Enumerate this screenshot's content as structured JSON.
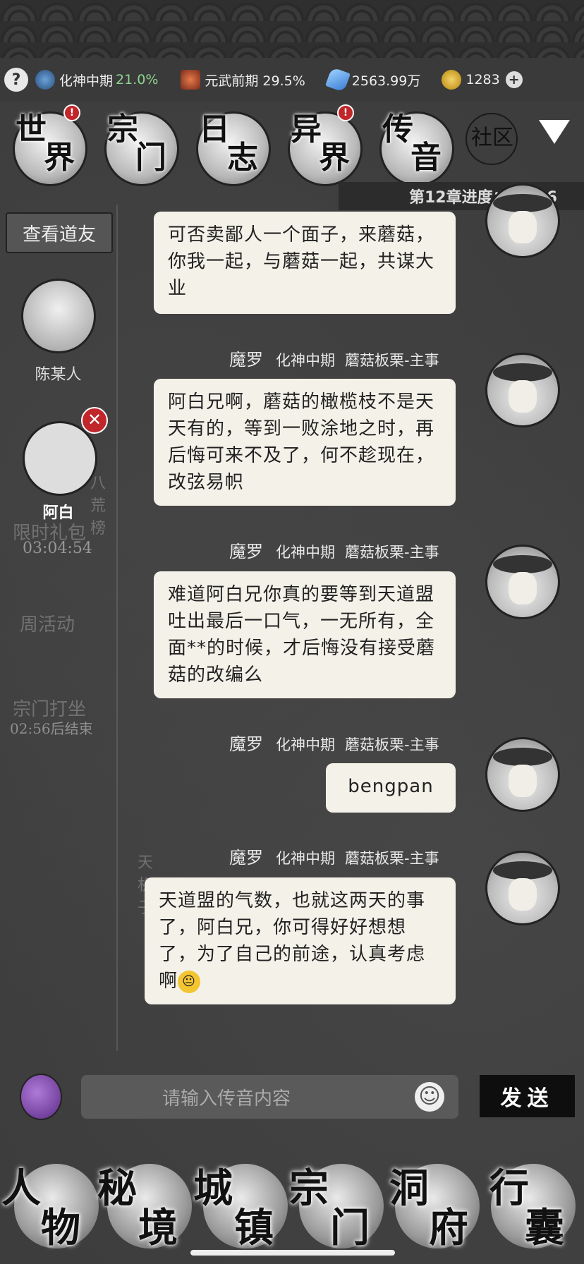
{
  "status": {
    "realm1_name": "化神中期",
    "realm1_pct": "21.0%",
    "realm2": "元武前期 29.5%",
    "stones": "2563.99万",
    "coins": "1283"
  },
  "nav": {
    "world": [
      "世",
      "界"
    ],
    "sect": [
      "宗",
      "门"
    ],
    "log": [
      "日",
      "志"
    ],
    "otherworld": [
      "异",
      "界"
    ],
    "message": [
      "传",
      "音"
    ],
    "community": "社区"
  },
  "chapter": "第12章进度：15/36",
  "sidebar": {
    "view_friends": "查看道友",
    "friend1": "陈某人",
    "friend2": "阿白",
    "timer1": "03:04:54",
    "faint_limited": "限时礼包",
    "faint_weekly": "周活动",
    "faint_sect": "宗门打坐",
    "timer2": "02:56后结束",
    "faint_rank": "八荒榜",
    "faint_tianjizi": "天机子"
  },
  "messages": [
    {
      "text": "可否卖鄙人一个面子，来蘑菇，你我一起，与蘑菇一起，共谋大业"
    },
    {
      "sender": "魔罗",
      "rank": "化神中期",
      "title": "蘑菇板栗-主事",
      "text": "阿白兄啊，蘑菇的橄榄枝不是天天有的，等到一败涂地之时，再后悔可来不及了，何不趁现在，改弦易帜"
    },
    {
      "sender": "魔罗",
      "rank": "化神中期",
      "title": "蘑菇板栗-主事",
      "text": "难道阿白兄你真的要等到天道盟吐出最后一口气，一无所有，全面**的时候，才后悔没有接受蘑菇的改编么"
    },
    {
      "sender": "魔罗",
      "rank": "化神中期",
      "title": "蘑菇板栗-主事",
      "text": "bengpan"
    },
    {
      "sender": "魔罗",
      "rank": "化神中期",
      "title": "蘑菇板栗-主事",
      "text": "天道盟的气数，也就这两天的事了，阿白兄，你可得好好想想了，为了自己的前途，认真考虑啊"
    }
  ],
  "input": {
    "placeholder": "请输入传音内容",
    "send": "发送"
  },
  "bottom_nav": {
    "character": [
      "人",
      "物"
    ],
    "secret": [
      "秘",
      "境"
    ],
    "town": [
      "城",
      "镇"
    ],
    "sect": [
      "宗",
      "门"
    ],
    "cave": [
      "洞",
      "府"
    ],
    "bag": [
      "行",
      "囊"
    ]
  }
}
